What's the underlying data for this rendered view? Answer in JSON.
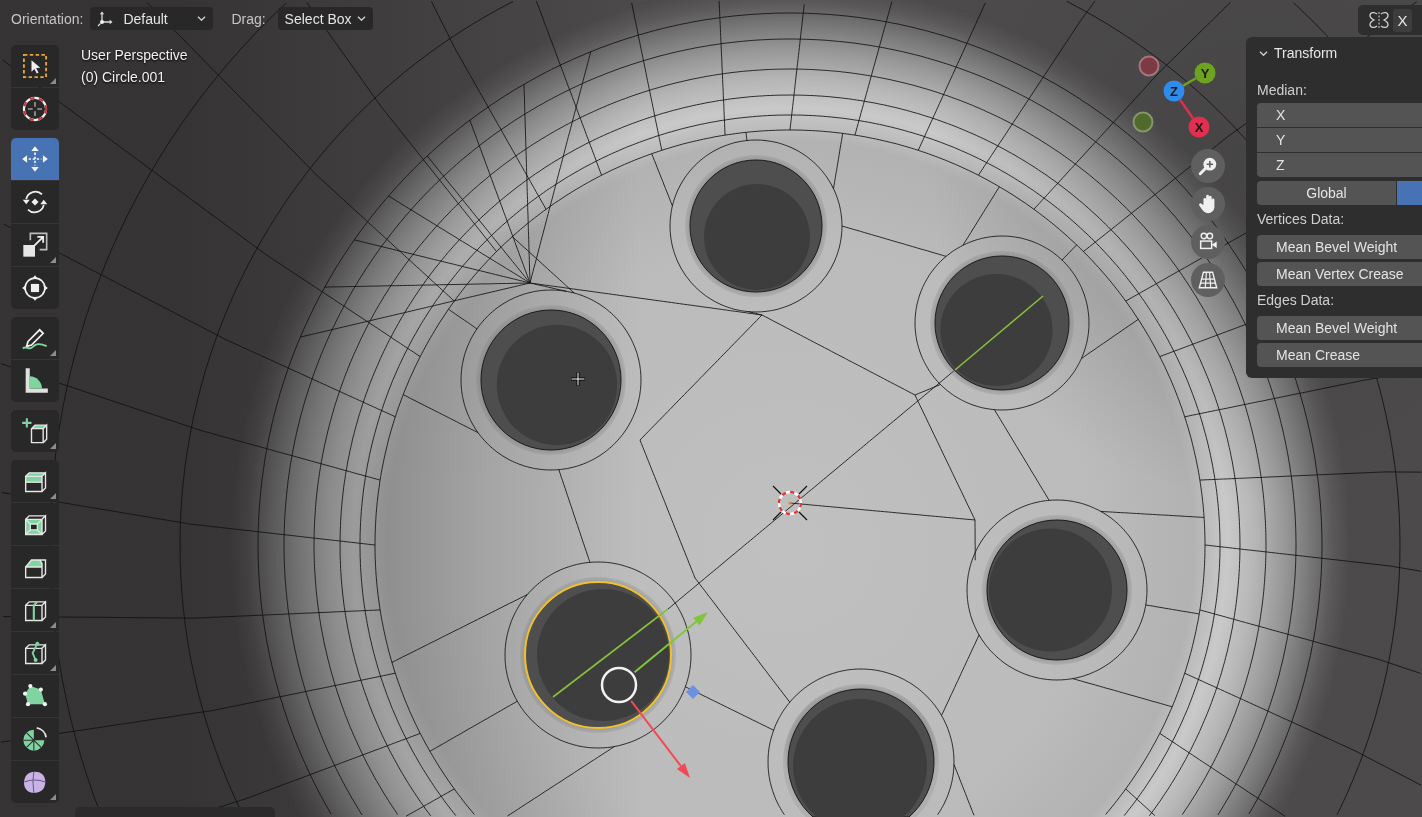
{
  "header": {
    "orientation": {
      "label": "Orientation:",
      "value": "Default"
    },
    "drag": {
      "label": "Drag:",
      "value": "Select Box"
    }
  },
  "mirror_axes": [
    {
      "label": "X"
    }
  ],
  "toolbar": {
    "groups": [
      {
        "tools": [
          {
            "kind": "selectbox",
            "selected": false,
            "submenu": true
          },
          {
            "kind": "cursor",
            "selected": false,
            "submenu": false
          }
        ]
      },
      {
        "tools": [
          {
            "kind": "move",
            "selected": true,
            "submenu": false
          },
          {
            "kind": "rotate",
            "selected": false,
            "submenu": false
          },
          {
            "kind": "scale",
            "selected": false,
            "submenu": true
          },
          {
            "kind": "transform",
            "selected": false,
            "submenu": false
          }
        ]
      },
      {
        "tools": [
          {
            "kind": "annotate",
            "selected": false,
            "submenu": true
          },
          {
            "kind": "measure",
            "selected": false,
            "submenu": false
          }
        ]
      },
      {
        "tools": [
          {
            "kind": "addcube",
            "selected": false,
            "submenu": true
          }
        ]
      },
      {
        "tools": [
          {
            "kind": "extrude",
            "selected": false,
            "submenu": true
          },
          {
            "kind": "inset",
            "selected": false,
            "submenu": false
          },
          {
            "kind": "bevel",
            "selected": false,
            "submenu": false
          },
          {
            "kind": "loopcut",
            "selected": false,
            "submenu": true
          },
          {
            "kind": "knife",
            "selected": false,
            "submenu": true
          },
          {
            "kind": "polybuild",
            "selected": false,
            "submenu": false
          },
          {
            "kind": "spin",
            "selected": false,
            "submenu": false
          },
          {
            "kind": "smooth",
            "selected": false,
            "submenu": true
          }
        ]
      }
    ]
  },
  "viewport_info": {
    "view": "User Perspective",
    "object": "(0) Circle.001"
  },
  "scene": {
    "holes": [
      {
        "selected": false
      },
      {
        "selected": false
      },
      {
        "selected": false
      },
      {
        "selected": false
      },
      {
        "selected": true
      },
      {
        "selected": false
      }
    ]
  },
  "navigation_gizmo": {
    "axes": [
      {
        "label": "Y",
        "color": "#6da320"
      },
      {
        "label": "Z",
        "color": "#2f8bec"
      },
      {
        "label": "X",
        "color": "#e0304d"
      }
    ],
    "negative_axes": [
      {
        "color": "#7c3a44"
      },
      {
        "color": "#4f6a2a"
      }
    ]
  },
  "sidebar": {
    "panel": {
      "title": "Transform",
      "expanded": true,
      "median": {
        "label": "Median:",
        "fields": [
          {
            "label": "X"
          },
          {
            "label": "Y"
          },
          {
            "label": "Z"
          }
        ]
      },
      "space_toggle": [
        {
          "label": "Global",
          "selected": false
        },
        {
          "selected": true
        }
      ],
      "sections": [
        {
          "label": "Vertices Data:",
          "fields": [
            {
              "label": "Mean Bevel Weight"
            },
            {
              "label": "Mean Vertex Crease"
            }
          ]
        },
        {
          "label": "Edges Data:",
          "fields": [
            {
              "label": "Mean Bevel Weight"
            },
            {
              "label": "Mean Crease"
            }
          ]
        }
      ]
    }
  }
}
